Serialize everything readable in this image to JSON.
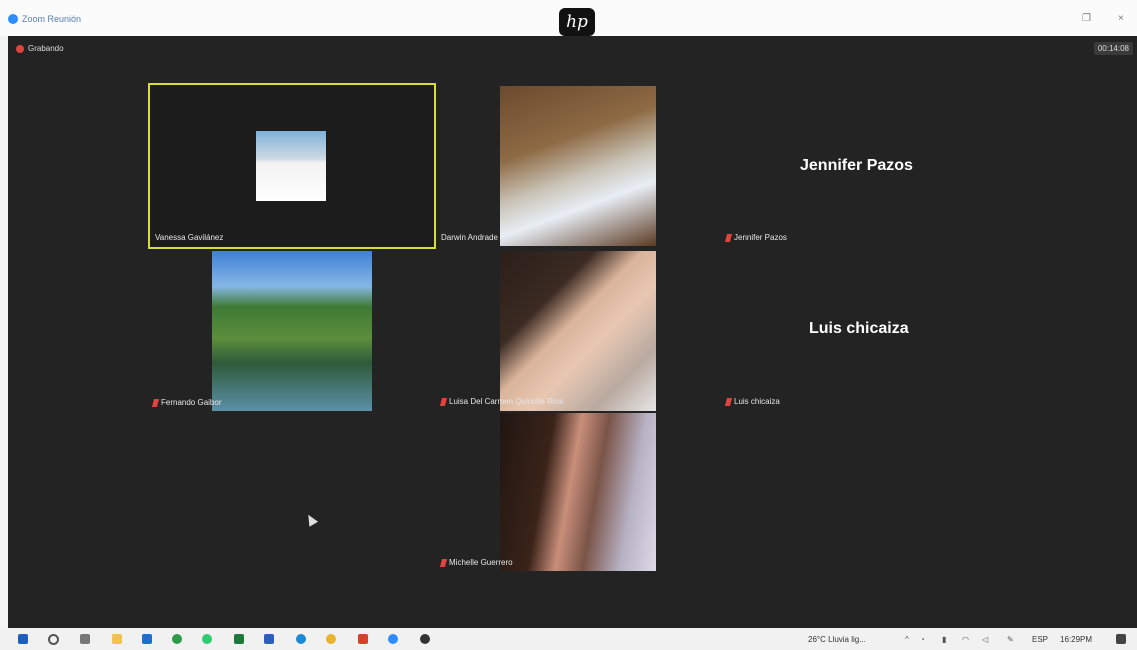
{
  "window": {
    "title": "Zoom Reunión"
  },
  "hp_logo": "hp",
  "meeting": {
    "recording_label": "Grabando",
    "timer": "00:14:08"
  },
  "participants": [
    {
      "name": "Vanessa Gavilánez",
      "active_speaker": true,
      "video": true
    },
    {
      "name": "Darwin Andrade",
      "video": true
    },
    {
      "name": "Jennifer Pazos",
      "video": false,
      "muted": true
    },
    {
      "name": "Fernando Gaibor",
      "video": true,
      "muted": true
    },
    {
      "name": "Luisa Del Carmen Quinche Rios",
      "video": true,
      "muted": true
    },
    {
      "name": "Luis chicaiza",
      "video": false,
      "muted": true
    },
    {
      "name": "Michelle Guerrero",
      "video": true,
      "muted": true
    }
  ],
  "taskbar": {
    "weather": "26°C Lluvia lig...",
    "language": "ESP",
    "time": "16:29PM"
  },
  "colors": {
    "active_border": "#d7de3c",
    "mute_red": "#e0443e",
    "stage_bg": "#232323"
  }
}
